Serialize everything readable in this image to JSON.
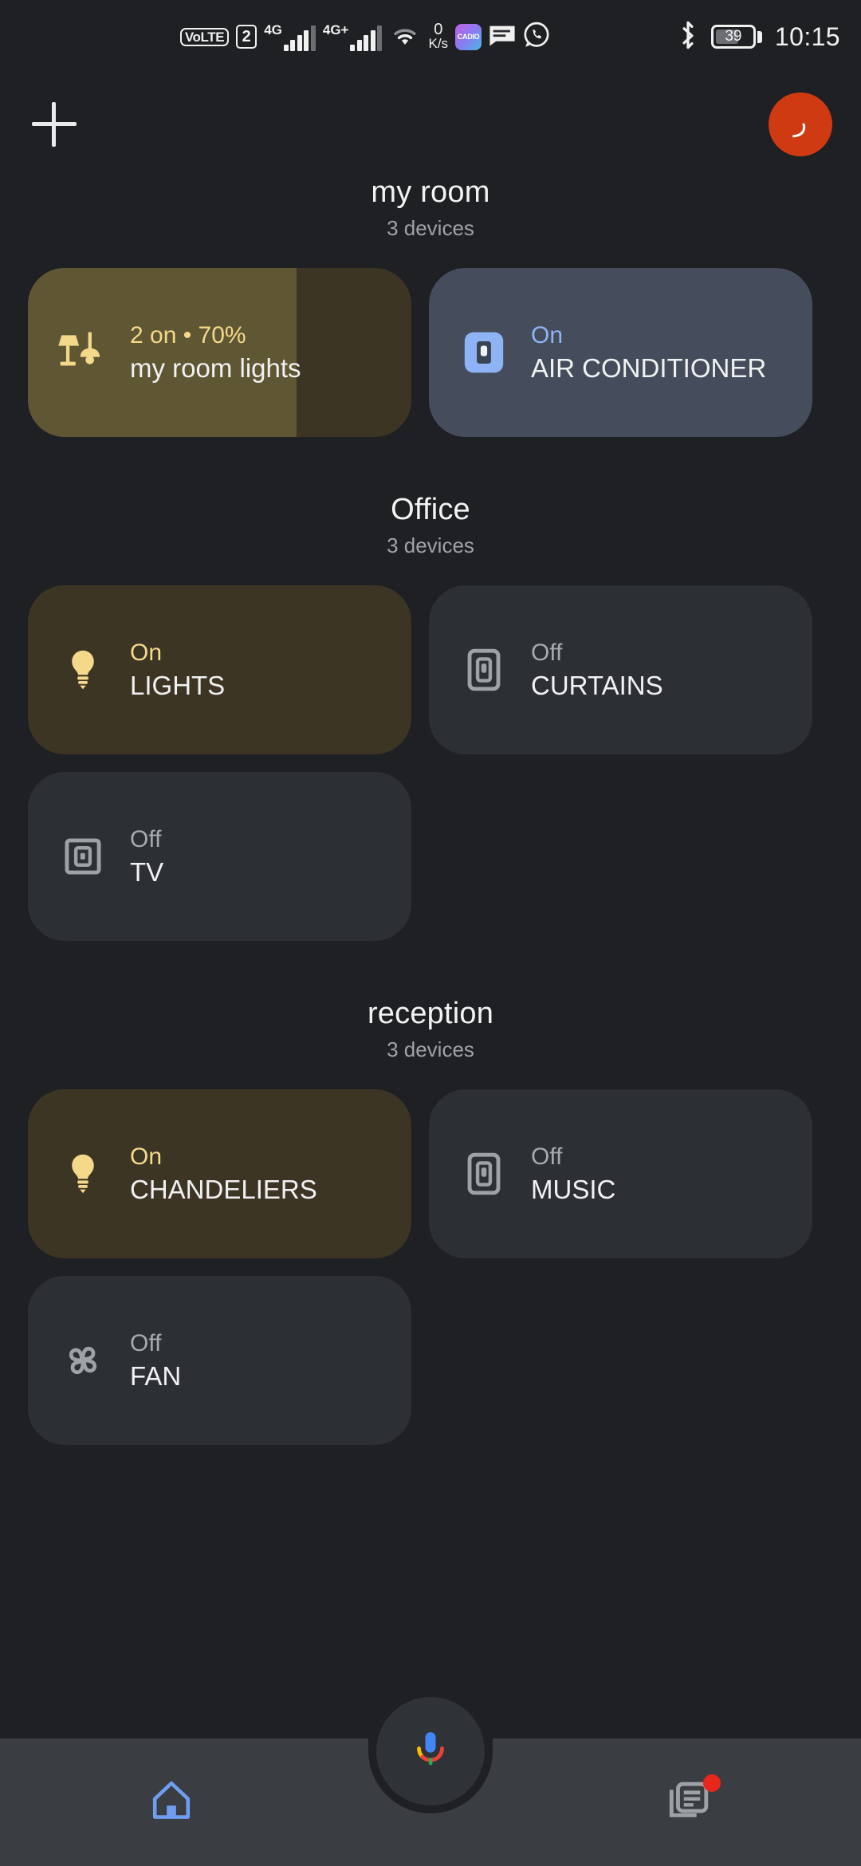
{
  "status_bar": {
    "volte_label": "VoLTE",
    "sim_number": "2",
    "network_1": "4G",
    "network_2": "4G+",
    "net_speed_value": "0",
    "net_speed_unit": "K/s",
    "app_icon_label": "CADIO",
    "battery_level": "39",
    "time": "10:15"
  },
  "action_bar": {
    "add_label": "+",
    "avatar_initial": "ر"
  },
  "sections": [
    {
      "title": "my room",
      "device_count": "3 devices",
      "devices": [
        {
          "state": "2 on • 70%",
          "name": "my room lights",
          "icon": "lamp-icon",
          "style": "light-on",
          "slider_percent": 70
        },
        {
          "state": "On",
          "name": "AIR CONDITIONER",
          "icon": "switch-icon",
          "style": "ac-on",
          "slider_percent": 0
        }
      ]
    },
    {
      "title": "Office",
      "device_count": "3 devices",
      "devices": [
        {
          "state": "On",
          "name": "LIGHTS",
          "icon": "bulb-icon",
          "style": "light-on",
          "slider_percent": 100
        },
        {
          "state": "Off",
          "name": "CURTAINS",
          "icon": "switch-icon",
          "style": "off",
          "slider_percent": 0
        },
        {
          "state": "Off",
          "name": "TV",
          "icon": "switch-icon",
          "style": "off",
          "slider_percent": 0
        }
      ]
    },
    {
      "title": "reception",
      "device_count": "3 devices",
      "devices": [
        {
          "state": "On",
          "name": "CHANDELIERS",
          "icon": "bulb-icon",
          "style": "light-on",
          "slider_percent": 100
        },
        {
          "state": "Off",
          "name": "MUSIC",
          "icon": "switch-icon",
          "style": "off",
          "slider_percent": 0
        },
        {
          "state": "Off",
          "name": "FAN",
          "icon": "fan-icon",
          "style": "off",
          "slider_percent": 0
        }
      ]
    }
  ],
  "bottom_nav": {
    "home_icon": "home-icon",
    "assistant_icon": "google-assistant-mic-icon",
    "feed_icon": "feed-icon",
    "feed_has_badge": true
  },
  "colors": {
    "background": "#1e2023",
    "card_off": "#2c2f33",
    "card_light_on": "#3c3524",
    "card_light_fill": "#5f5633",
    "card_ac": "#454d5c",
    "accent_amber": "#f5d98b",
    "accent_blue": "#8eb4f5",
    "avatar": "#d03a12",
    "badge_red": "#e8271a",
    "nav_bar": "#3a3d41"
  }
}
